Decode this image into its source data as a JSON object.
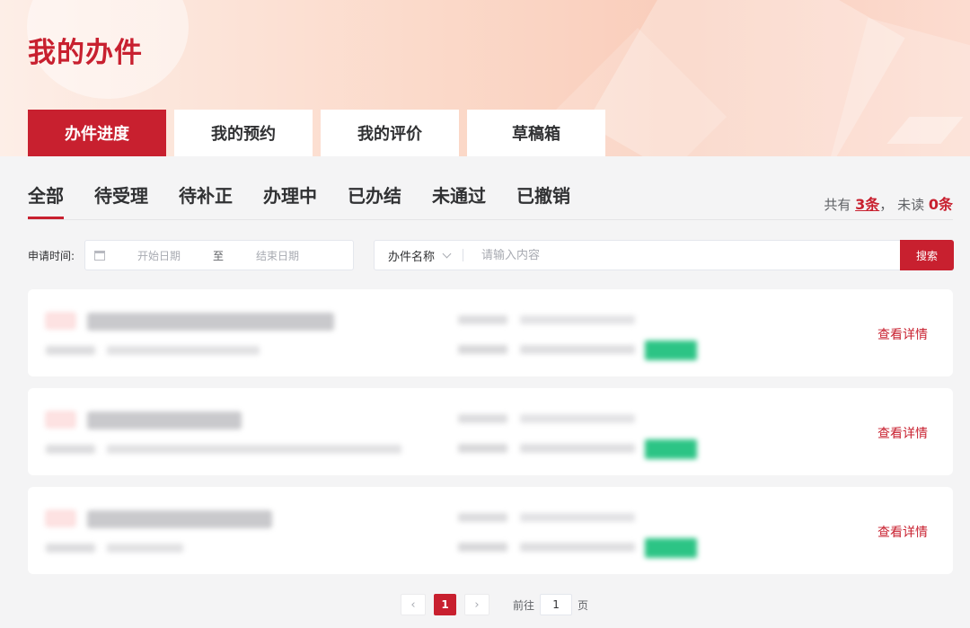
{
  "header": {
    "title": "我的办件",
    "tabs": [
      {
        "label": "办件进度",
        "active": true
      },
      {
        "label": "我的预约",
        "active": false
      },
      {
        "label": "我的评价",
        "active": false
      },
      {
        "label": "草稿箱",
        "active": false
      }
    ]
  },
  "status_tabs": [
    {
      "label": "全部",
      "active": true
    },
    {
      "label": "待受理",
      "active": false
    },
    {
      "label": "待补正",
      "active": false
    },
    {
      "label": "办理中",
      "active": false
    },
    {
      "label": "已办结",
      "active": false
    },
    {
      "label": "未通过",
      "active": false
    },
    {
      "label": "已撤销",
      "active": false
    }
  ],
  "summary": {
    "prefix": "共有",
    "total": "3条",
    "sep": "，",
    "unread_label": "未读",
    "unread": "0条"
  },
  "filter": {
    "date_label": "申请时间:",
    "start_placeholder": "开始日期",
    "range_sep": "至",
    "end_placeholder": "结束日期",
    "search_type": "办件名称",
    "search_placeholder": "请输入内容",
    "search_button": "搜索"
  },
  "cards": [
    {
      "detail_label": "查看详情"
    },
    {
      "detail_label": "查看详情"
    },
    {
      "detail_label": "查看详情"
    }
  ],
  "pagination": {
    "current": "1",
    "goto_label": "前往",
    "goto_value": "1",
    "page_suffix": "页"
  },
  "colors": {
    "accent": "#c8202f",
    "success": "#2cc485"
  }
}
